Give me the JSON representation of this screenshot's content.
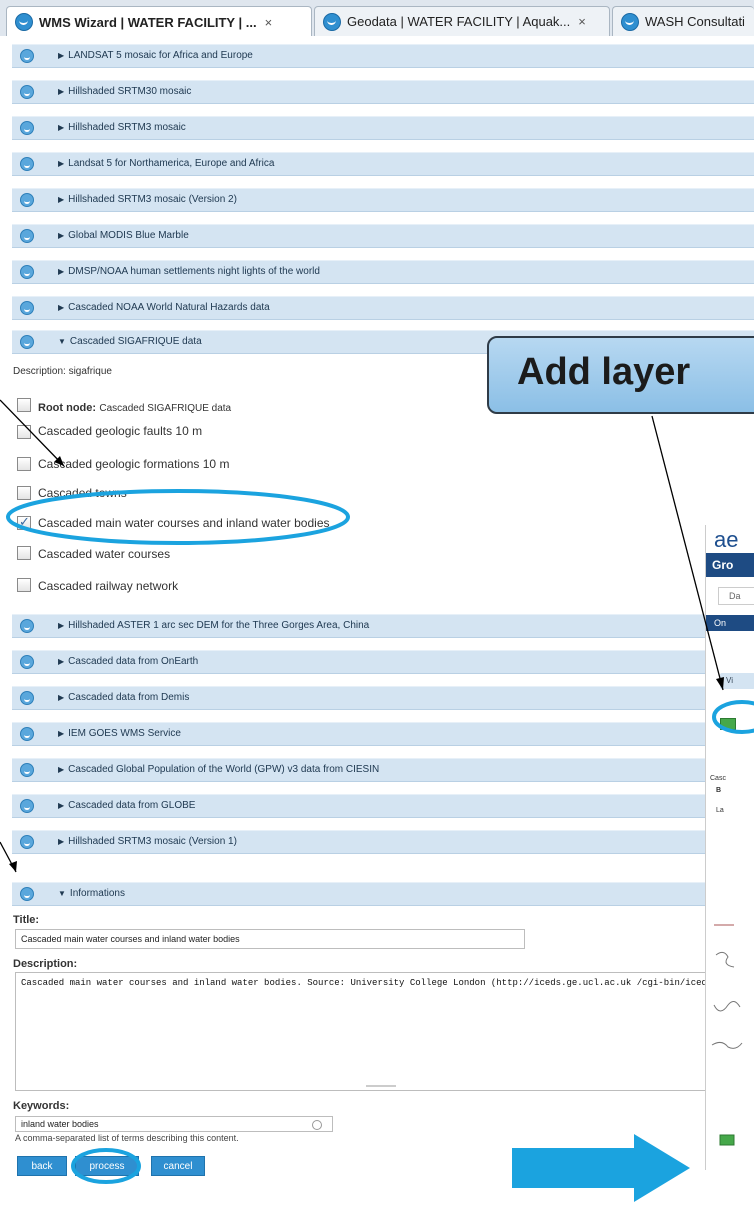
{
  "browser": {
    "tabs": [
      {
        "title": "WMS Wizard | WATER FACILITY | ...",
        "close": "×",
        "active": true
      },
      {
        "title": "Geodata | WATER FACILITY | Aquak...",
        "close": "×",
        "active": false
      },
      {
        "title": "WASH Consultati",
        "close": "",
        "active": false
      }
    ]
  },
  "layers_top": [
    "LANDSAT 5 mosaic for Africa and Europe",
    "Hillshaded SRTM30 mosaic",
    "Hillshaded SRTM3 mosaic",
    "Landsat 5 for Northamerica, Europe and Africa",
    "Hillshaded SRTM3 mosaic (Version 2)",
    "Global MODIS Blue Marble",
    "DMSP/NOAA human settlements night lights of the world",
    "Cascaded NOAA World Natural Hazards data"
  ],
  "expanded_layer": {
    "title": "Cascaded SIGAFRIQUE data",
    "description": "Description: sigafrique",
    "root_label": "Root node:",
    "root_value": "Cascaded SIGAFRIQUE data",
    "children": [
      {
        "label": "Cascaded geologic faults 10 m",
        "checked": false
      },
      {
        "label": "Cascaded geologic formations 10 m",
        "checked": false
      },
      {
        "label": "Cascaded towns",
        "checked": false
      },
      {
        "label": "Cascaded main water courses and inland water bodies",
        "checked": true
      },
      {
        "label": "Cascaded water courses",
        "checked": false
      },
      {
        "label": "Cascaded railway network",
        "checked": false
      }
    ]
  },
  "layers_bottom": [
    "Hillshaded ASTER 1 arc sec DEM for the Three Gorges Area, China",
    "Cascaded data from OnEarth",
    "Cascaded data from Demis",
    "IEM GOES WMS Service",
    "Cascaded Global Population of the World (GPW) v3 data from CIESIN",
    "Cascaded data from GLOBE",
    "Hillshaded SRTM3 mosaic (Version 1)"
  ],
  "informations": {
    "header": "Informations",
    "title_label": "Title:",
    "title_value": "Cascaded main water courses and inland water bodies",
    "description_label": "Description:",
    "description_value": "Cascaded main water courses and inland water bodies. Source: University College London (http://iceds.ge.ucl.ac.uk /cgi-bin/icedswms?)",
    "keywords_label": "Keywords:",
    "keywords_value": "inland water bodies",
    "keywords_hint": "A comma-separated list of terms describing this content."
  },
  "buttons": {
    "back": "back",
    "process": "process",
    "cancel": "cancel"
  },
  "annotation": {
    "callout": "Add layer"
  },
  "right_pane": {
    "logo": "ae",
    "bar": "Gro",
    "tab": "Da",
    "nav": "On",
    "group": "Vi",
    "small1": "Casc",
    "small2": "B",
    "small3": "La"
  },
  "colors": {
    "accent": "#2f8fd0",
    "row": "#d4e4f2",
    "highlight": "#1ba3df",
    "nav": "#1e4b83"
  }
}
